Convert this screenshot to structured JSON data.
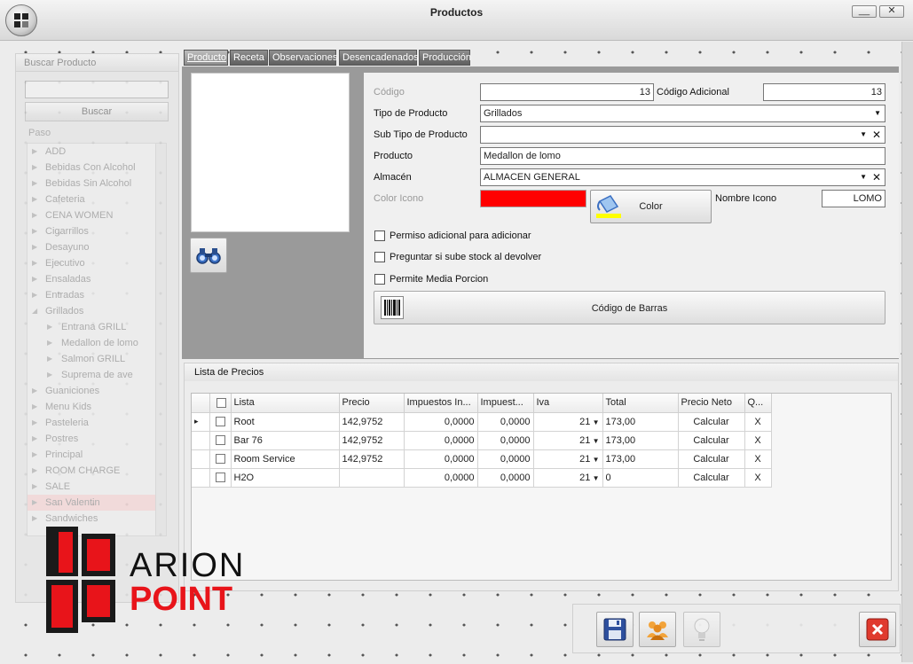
{
  "window": {
    "title": "Productos",
    "minimize_label": "__",
    "close_label": "✕"
  },
  "search_panel": {
    "header": "Buscar Producto",
    "search_value": "",
    "search_button": "Buscar",
    "step_label": "Paso",
    "tree_items": [
      {
        "label": "ADD",
        "level": 0
      },
      {
        "label": "Bebidas Con Alcohol",
        "level": 0
      },
      {
        "label": "Bebidas Sin Alcohol",
        "level": 0
      },
      {
        "label": "Cafeteria",
        "level": 0
      },
      {
        "label": "CENA WOMEN",
        "level": 0
      },
      {
        "label": "Cigarrillos",
        "level": 0
      },
      {
        "label": "Desayuno",
        "level": 0
      },
      {
        "label": "Ejecutivo",
        "level": 0
      },
      {
        "label": "Ensaladas",
        "level": 0
      },
      {
        "label": "Entradas",
        "level": 0
      },
      {
        "label": "Grillados",
        "level": 0,
        "expanded": true
      },
      {
        "label": "Entrana GRILL",
        "level": 1
      },
      {
        "label": "Medallon de lomo",
        "level": 1
      },
      {
        "label": "Salmon GRILL",
        "level": 1
      },
      {
        "label": "Suprema de ave",
        "level": 1
      },
      {
        "label": "Guaniciones",
        "level": 0
      },
      {
        "label": "Menu Kids",
        "level": 0
      },
      {
        "label": "Pasteleria",
        "level": 0
      },
      {
        "label": "Postres",
        "level": 0
      },
      {
        "label": "Principal",
        "level": 0
      },
      {
        "label": "ROOM CHARGE",
        "level": 0
      },
      {
        "label": "SALE",
        "level": 0
      },
      {
        "label": "San Valentin",
        "level": 0,
        "selected": true
      },
      {
        "label": "Sandwiches",
        "level": 0
      }
    ]
  },
  "tabs": [
    "Producto",
    "Receta",
    "Observaciones",
    "Desencadenados",
    "Producción"
  ],
  "form": {
    "codigo_label": "Código",
    "codigo_value": "13",
    "codigo_adicional_label": "Código Adicional",
    "codigo_adicional_value": "13",
    "tipo_label": "Tipo de Producto",
    "tipo_value": "Grillados",
    "subtipo_label": "Sub Tipo de Producto",
    "subtipo_value": "",
    "producto_label": "Producto",
    "producto_value": "Medallon de lomo",
    "almacen_label": "Almacén",
    "almacen_value": "ALMACEN GENERAL",
    "color_icono_label": "Color Icono",
    "color_icono_value": "#ff0000",
    "color_button": "Color",
    "nombre_icono_label": "Nombre Icono",
    "nombre_icono_value": "LOMO",
    "check_permiso": "Permiso adicional para adicionar",
    "check_preguntar": "Preguntar si sube stock al devolver",
    "check_media": "Permite Media Porcion",
    "barcode_button": "Código de Barras"
  },
  "prices": {
    "header": "Lista de Precios",
    "columns": [
      "Lista",
      "Precio",
      "Impuestos In...",
      "Impuest...",
      "Iva",
      "Total",
      "Precio Neto",
      "Q..."
    ],
    "rows": [
      {
        "lista": "Root",
        "precio": "142,9752",
        "imp_in": "0,0000",
        "imp": "0,0000",
        "iva": "21",
        "total": "173,00",
        "neto": "Calcular",
        "q": "X"
      },
      {
        "lista": "Bar 76",
        "precio": "142,9752",
        "imp_in": "0,0000",
        "imp": "0,0000",
        "iva": "21",
        "total": "173,00",
        "neto": "Calcular",
        "q": "X"
      },
      {
        "lista": "Room Service",
        "precio": "142,9752",
        "imp_in": "0,0000",
        "imp": "0,0000",
        "iva": "21",
        "total": "173,00",
        "neto": "Calcular",
        "q": "X"
      },
      {
        "lista": "H2O",
        "precio": "",
        "imp_in": "0,0000",
        "imp": "0,0000",
        "iva": "21",
        "total": "0",
        "neto": "Calcular",
        "q": "X"
      }
    ]
  },
  "brand": {
    "line1": "ARION",
    "line2": "POINT",
    "accent": "#e8141a"
  }
}
